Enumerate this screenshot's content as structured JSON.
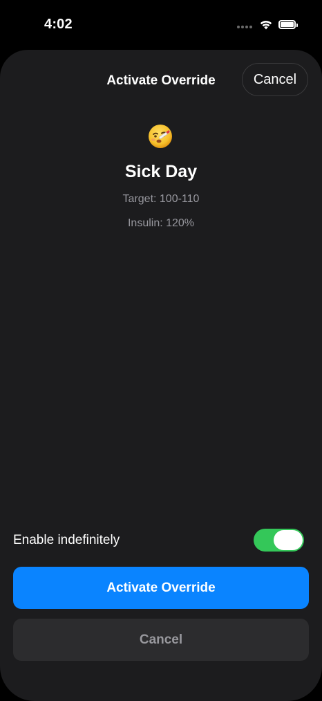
{
  "status_bar": {
    "time": "4:02"
  },
  "sheet": {
    "title": "Activate Override",
    "cancel_label": "Cancel"
  },
  "preset": {
    "icon": "sick-face-thermometer-emoji",
    "name": "Sick Day",
    "target_text": "Target: 100-110",
    "insulin_text": "Insulin: 120%"
  },
  "options": {
    "enable_indefinitely_label": "Enable indefinitely",
    "enable_indefinitely_on": true
  },
  "actions": {
    "activate_label": "Activate Override",
    "cancel_label": "Cancel"
  },
  "colors": {
    "accent": "#0a84ff",
    "toggle_on": "#34c759",
    "sheet_bg": "#1c1c1e",
    "secondary_text": "#98989f"
  }
}
